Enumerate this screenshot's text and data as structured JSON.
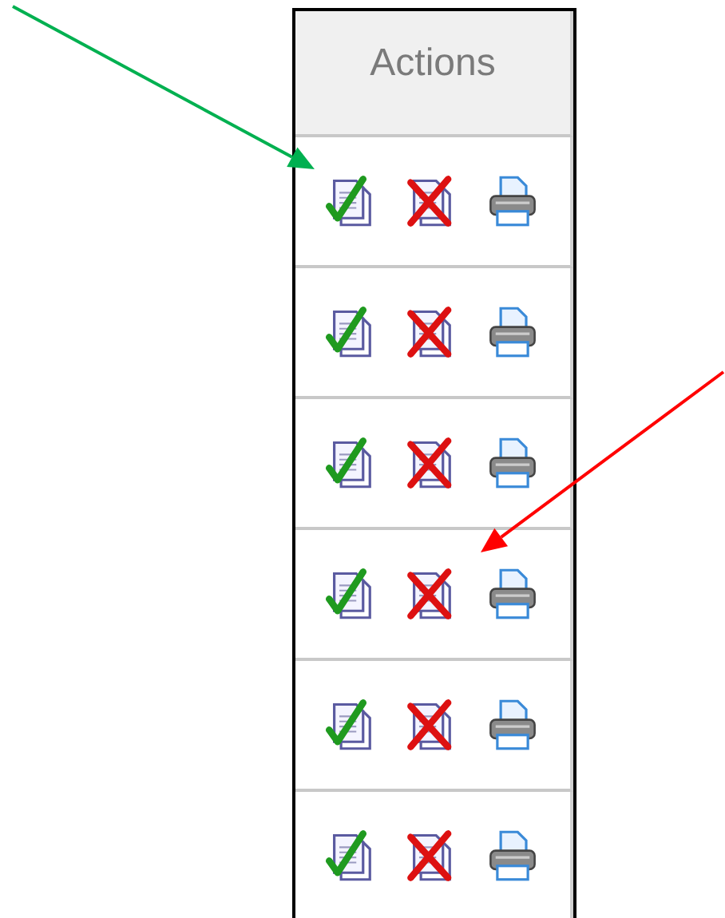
{
  "table": {
    "columns": [
      {
        "label": "Actions"
      }
    ],
    "rows": [
      {
        "actions": [
          {
            "kind": "approve"
          },
          {
            "kind": "reject"
          },
          {
            "kind": "print"
          }
        ]
      },
      {
        "actions": [
          {
            "kind": "approve"
          },
          {
            "kind": "reject"
          },
          {
            "kind": "print"
          }
        ]
      },
      {
        "actions": [
          {
            "kind": "approve"
          },
          {
            "kind": "reject"
          },
          {
            "kind": "print"
          }
        ]
      },
      {
        "actions": [
          {
            "kind": "approve"
          },
          {
            "kind": "reject"
          },
          {
            "kind": "print"
          }
        ]
      },
      {
        "actions": [
          {
            "kind": "approve"
          },
          {
            "kind": "reject"
          },
          {
            "kind": "print"
          }
        ]
      },
      {
        "actions": [
          {
            "kind": "approve"
          },
          {
            "kind": "reject"
          },
          {
            "kind": "print"
          }
        ]
      }
    ]
  },
  "annotations": [
    {
      "kind": "arrow",
      "color": "#00b050"
    },
    {
      "kind": "arrow",
      "color": "#ff0000"
    }
  ]
}
